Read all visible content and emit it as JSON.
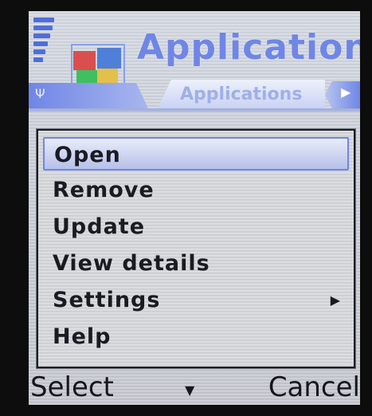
{
  "header": {
    "title": "Applications",
    "tab_label": "Applications",
    "signal_icon": "signal-bars-icon",
    "app_icon": "applications-icon",
    "antenna_icon": "antenna-icon",
    "tab_arrow_icon": "right-arrow-icon"
  },
  "menu": {
    "items": [
      {
        "label": "Open",
        "selected": true
      },
      {
        "label": "Remove",
        "selected": false
      },
      {
        "label": "Update",
        "selected": false
      },
      {
        "label": "View details",
        "selected": false
      },
      {
        "label": "Settings",
        "selected": false,
        "has_submenu": true
      },
      {
        "label": "Help",
        "selected": false
      }
    ],
    "submenu_arrow_icon": "submenu-arrow-icon"
  },
  "softkeys": {
    "left": "Select",
    "middle_icon": "down-arrow-icon",
    "right": "Cancel"
  },
  "colors": {
    "accent": "#6f86e6",
    "text": "#1a1b22",
    "menu_bg": "#d7d9dd"
  }
}
